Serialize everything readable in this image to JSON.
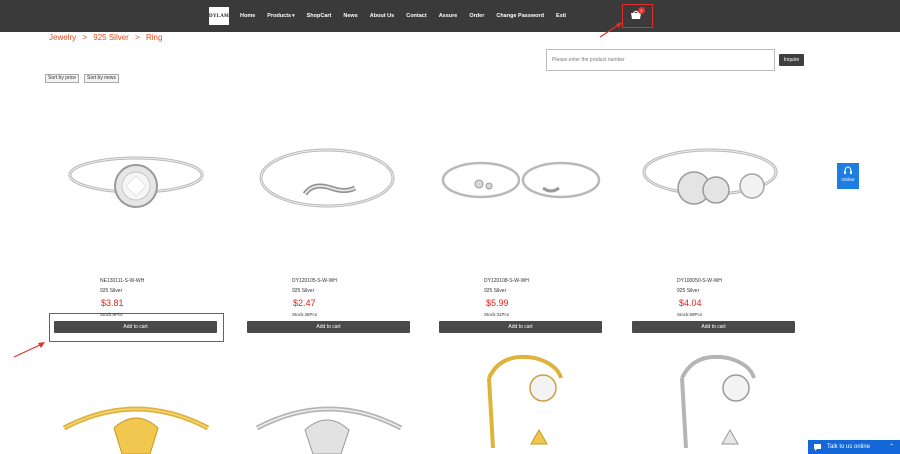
{
  "nav": {
    "logo": "DYLAM",
    "items": [
      "Home",
      "Products",
      "ShopCart",
      "News",
      "About Us",
      "Contact",
      "Assure",
      "Order",
      "Change Password",
      "Exit"
    ],
    "cart_count": "1"
  },
  "breadcrumb": [
    "Jewelry",
    ">",
    "925 Silver",
    ">",
    "Ring"
  ],
  "search": {
    "placeholder": "Please enter the product number",
    "button": "Inquire"
  },
  "sort": {
    "by_price": "Sort by price",
    "by_news": "Sort by news"
  },
  "products": [
    {
      "code": "NE130111-S-W-WH",
      "material": "925 Silver",
      "price": "$3.81",
      "stock": "Stock:8Pcs",
      "add_label": "Add to cart"
    },
    {
      "code": "DY120105-S-W-WH",
      "material": "925 Silver",
      "price": "$2.47",
      "stock": "Stock:35Pcs",
      "add_label": "Add to cart"
    },
    {
      "code": "DY120108-S-W-WH",
      "material": "925 Silver",
      "price": "$5.99",
      "stock": "Stock:31Pcs",
      "add_label": "Add to cart"
    },
    {
      "code": "DY100050-S-W-WH",
      "material": "925 Silver",
      "price": "$4.04",
      "stock": "Stock:69Pcs",
      "add_label": "Add to cart"
    }
  ],
  "online_label": "Online",
  "talk_label": "Talk to us online",
  "colors": {
    "nav_bg": "#3a3a3a",
    "breadcrumb": "#e54b1d",
    "price": "#e0241d",
    "button_bg": "#4a4a4a",
    "annotation": "#e0302b",
    "online_bg": "#1e7de1",
    "talk_bg": "#1467d8"
  }
}
